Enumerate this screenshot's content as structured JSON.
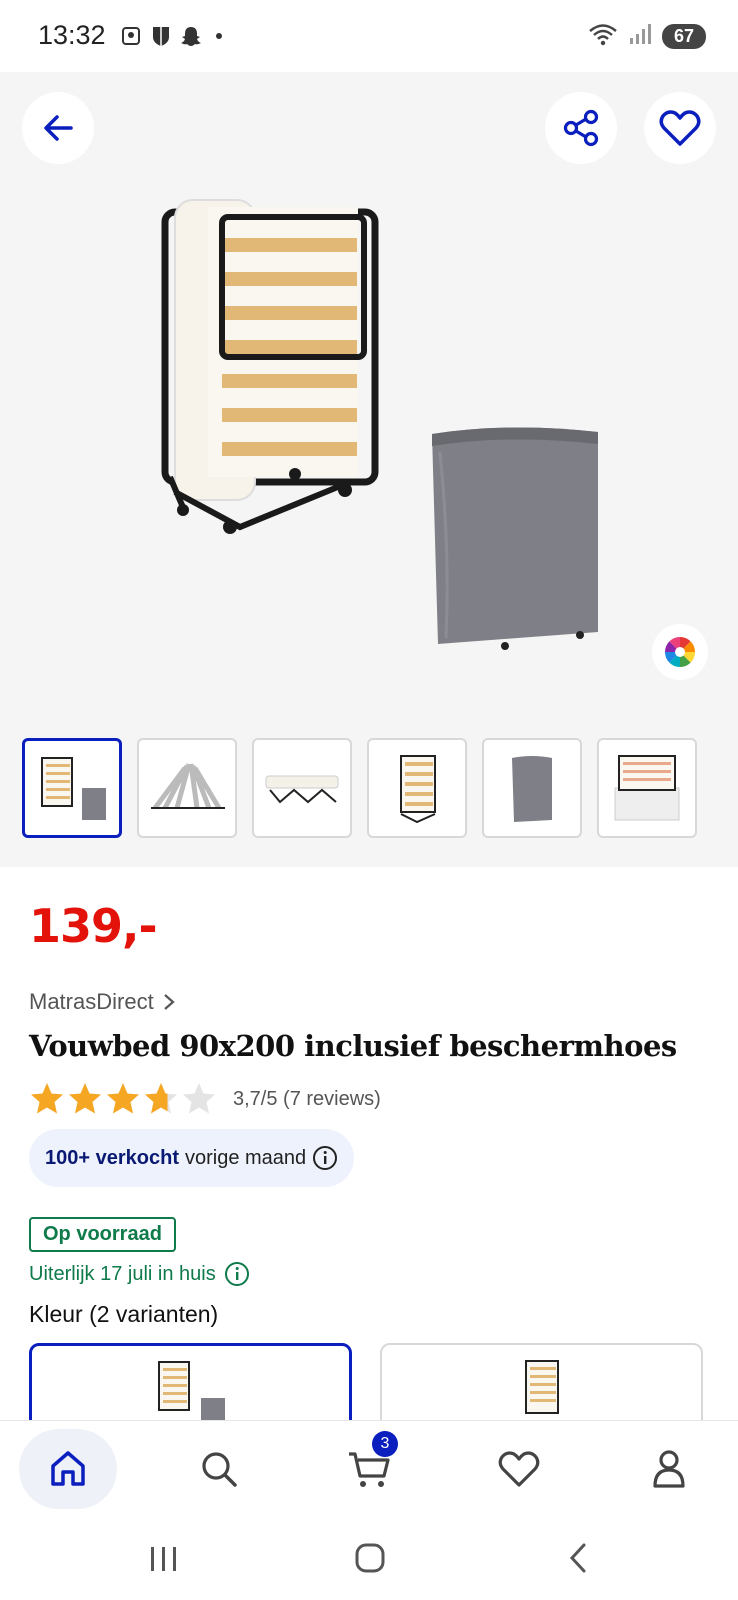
{
  "status_bar": {
    "time": "13:32",
    "icons": [
      "gallery-icon",
      "shield-icon",
      "snapchat-icon"
    ],
    "battery": "67",
    "signal_icons": [
      "wifi-icon",
      "signal-icon"
    ]
  },
  "gallery": {
    "thumbnail_count": 6,
    "active_thumbnail": 0
  },
  "product": {
    "price": "139,-",
    "seller": "MatrasDirect",
    "title": "Vouwbed 90x200 inclusief beschermhoes",
    "rating_value": 3.7,
    "rating_max": 5,
    "rating_text": "3,7/5 (7 reviews)",
    "sold_strong": "100+ verkocht",
    "sold_rest": "vorige maand",
    "stock": "Op voorraad",
    "delivery": "Uiterlijk 17 juli in huis",
    "color_label": "Kleur (2 varianten)"
  },
  "nav": {
    "items": [
      "home-icon",
      "search-icon",
      "cart-icon",
      "heart-icon",
      "account-icon"
    ],
    "cart_count": "3"
  },
  "colors": {
    "accent": "#0a1fbe",
    "price": "#e3120b",
    "stock": "#0f7a4a",
    "star": "#f5a623"
  }
}
